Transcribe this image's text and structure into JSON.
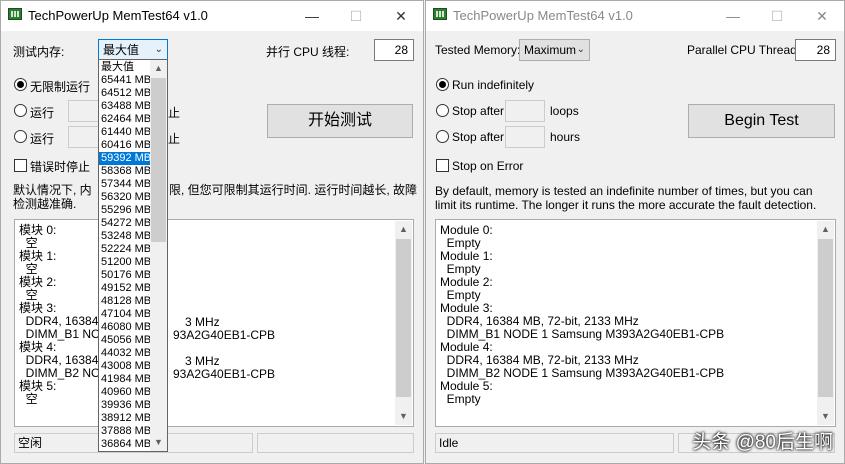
{
  "left": {
    "title": "TechPowerUp MemTest64 v1.0",
    "minimize": "—",
    "maximize": "☐",
    "close": "✕",
    "memory_label": "测试内存:",
    "memory_value": "最大值",
    "threads_label": "并行 CPU 线程:",
    "threads_value": "28",
    "radio_indefinite": "无限制运行",
    "radio_loops": "运行",
    "radio_hours": "运行",
    "loops_unit": "止",
    "hours_unit": "止",
    "begin_button": "开始测试",
    "stop_on_error": "错误时停止",
    "description": "默认情况下, 内存会无限次的测试, 但您可限制其运行时间. 运行时间越长, 故障检测越准确.",
    "description_visible_1": "默认情况下, 内",
    "description_visible_2": "限, 但您可限制其运行时间. 运行时间越长, 故障",
    "description_visible_3": "检测越准确.",
    "modules_text": "模块 0:\n  空\n模块 1:\n  空\n模块 2:\n  空\n模块 3:\n  DDR4, 16384 M\n  DIMM_B1 NODE\n模块 4:\n  DDR4, 16384 M\n  DIMM_B2 NODE\n模块 5:\n  空",
    "modules_right_1": "3 MHz",
    "modules_right_2": "93A2G40EB1-CPB",
    "modules_right_3": "3 MHz",
    "modules_right_4": "93A2G40EB1-CPB",
    "status": "空闲",
    "dropdown_options": [
      "最大值",
      "65441 MB",
      "64512 MB",
      "63488 MB",
      "62464 MB",
      "61440 MB",
      "60416 MB",
      "59392 MB",
      "58368 MB",
      "57344 MB",
      "56320 MB",
      "55296 MB",
      "54272 MB",
      "53248 MB",
      "52224 MB",
      "51200 MB",
      "50176 MB",
      "49152 MB",
      "48128 MB",
      "47104 MB",
      "46080 MB",
      "45056 MB",
      "44032 MB",
      "43008 MB",
      "41984 MB",
      "40960 MB",
      "39936 MB",
      "38912 MB",
      "37888 MB",
      "36864 MB"
    ],
    "dropdown_selected": "59392 MB"
  },
  "right": {
    "title": "TechPowerUp MemTest64 v1.0",
    "minimize": "—",
    "maximize": "☐",
    "close": "✕",
    "memory_label": "Tested Memory:",
    "memory_value": "Maximum",
    "threads_label": "Parallel CPU Threads:",
    "threads_value": "28",
    "radio_indefinite": "Run indefinitely",
    "radio_loops": "Stop after",
    "loops_unit": "loops",
    "radio_hours": "Stop after",
    "hours_unit": "hours",
    "begin_button": "Begin Test",
    "stop_on_error": "Stop on Error",
    "description": "By default, memory is tested an indefinite number of times, but you can limit its runtime. The longer it runs the more accurate the fault detection.",
    "modules_text": "Module 0:\n  Empty\nModule 1:\n  Empty\nModule 2:\n  Empty\nModule 3:\n  DDR4, 16384 MB, 72-bit, 2133 MHz\n  DIMM_B1 NODE 1 Samsung M393A2G40EB1-CPB\nModule 4:\n  DDR4, 16384 MB, 72-bit, 2133 MHz\n  DIMM_B2 NODE 1 Samsung M393A2G40EB1-CPB\nModule 5:\n  Empty",
    "status": "Idle"
  },
  "watermark": "头条 @80后生啊",
  "colors": {
    "accent": "#0078d7",
    "window_bg": "#f0f0f0"
  }
}
